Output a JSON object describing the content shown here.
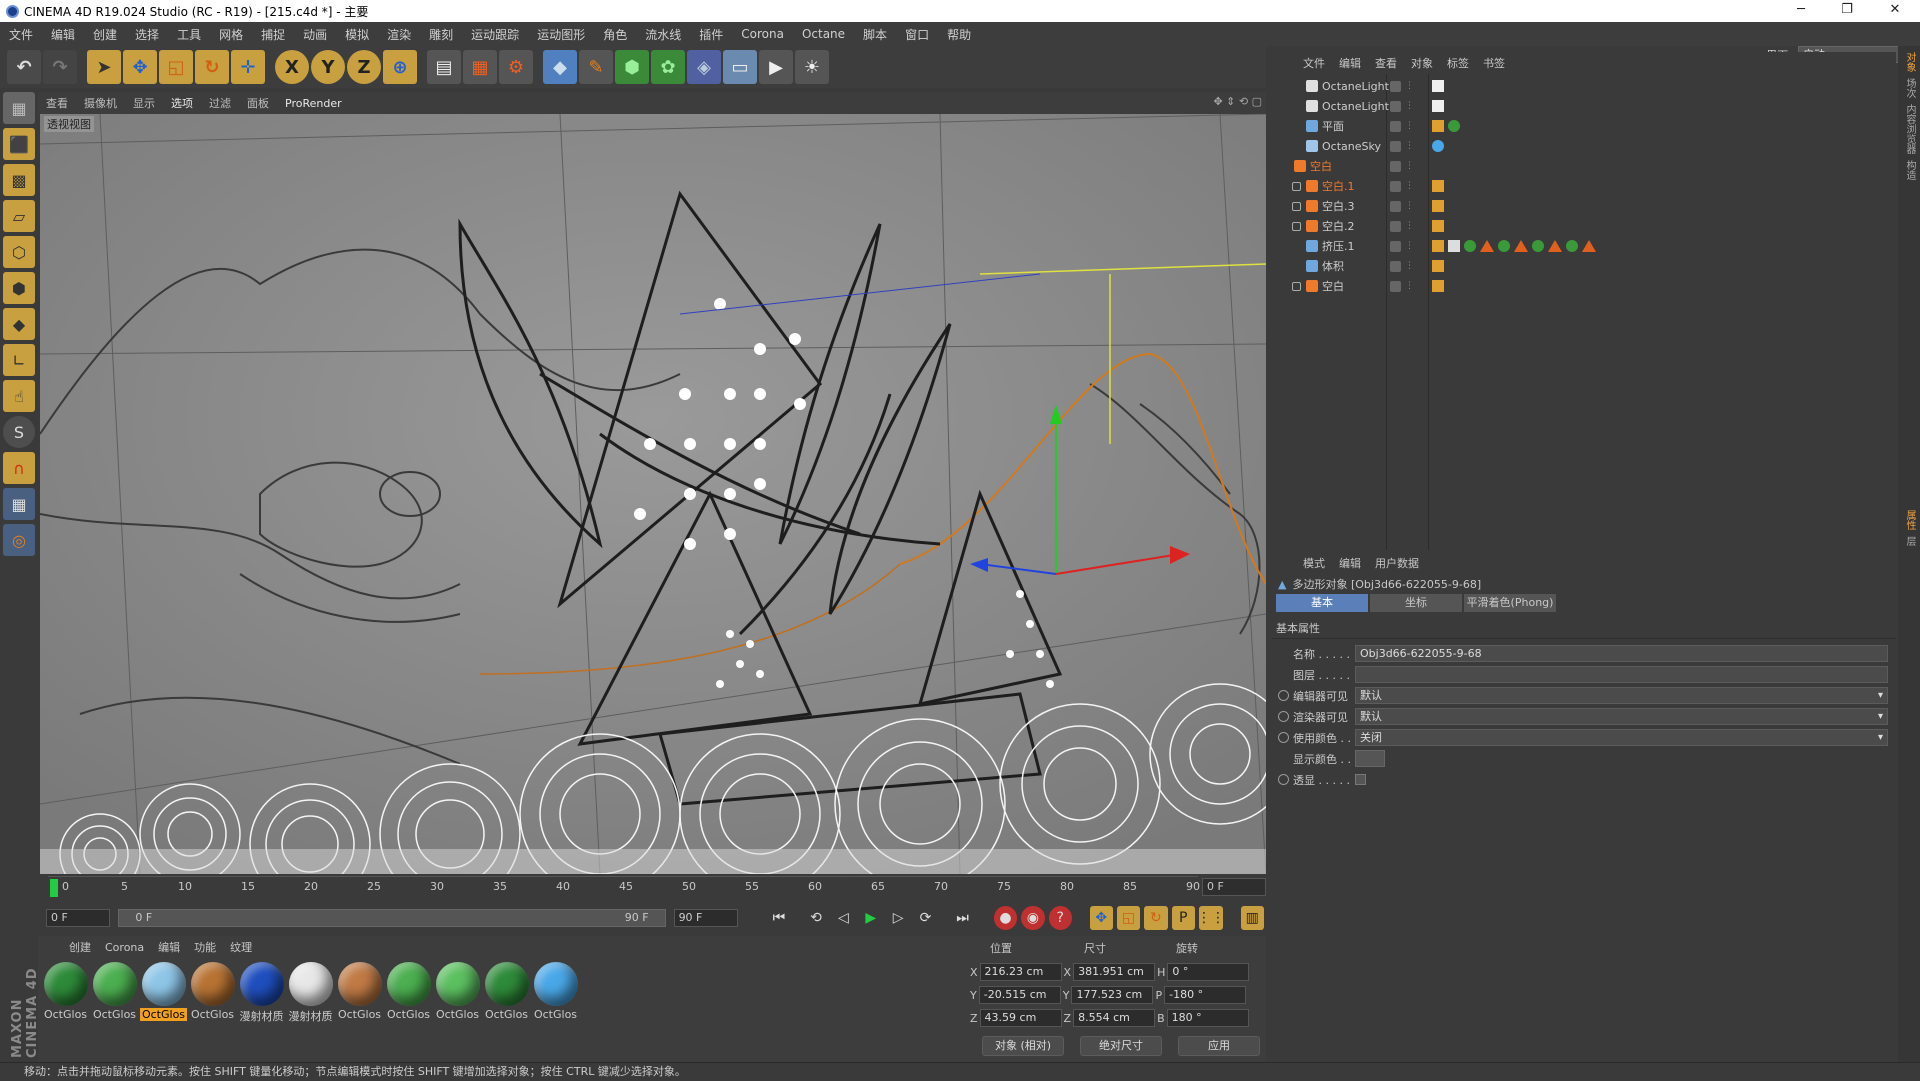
{
  "window": {
    "title": "CINEMA 4D R19.024 Studio (RC - R19) - [215.c4d *] - 主要",
    "min": "─",
    "max": "❐",
    "close": "✕"
  },
  "menu": [
    "文件",
    "编辑",
    "创建",
    "选择",
    "工具",
    "网格",
    "捕捉",
    "动画",
    "模拟",
    "渲染",
    "雕刻",
    "运动跟踪",
    "运动图形",
    "角色",
    "流水线",
    "插件",
    "Corona",
    "Octane",
    "脚本",
    "窗口",
    "帮助"
  ],
  "layout": {
    "label": "界面:",
    "value": "启动"
  },
  "toolbar_icons": [
    "undo-icon",
    "redo-icon",
    "select-arrow-icon",
    "move-icon",
    "scale-icon",
    "rotate-icon",
    "last-tool-icon",
    "x-axis-icon",
    "y-axis-icon",
    "z-axis-icon",
    "world-coord-icon",
    "render-view-icon",
    "render-picture-viewer-icon",
    "render-settings-icon",
    "cube-icon",
    "pen-spline-icon",
    "subdivision-icon",
    "array-icon",
    "deformer-icon",
    "floor-icon",
    "camera-icon",
    "light-icon"
  ],
  "toolbar_letters": {
    "x": "X",
    "y": "Y",
    "z": "Z"
  },
  "viewport_menu": [
    "查看",
    "摄像机",
    "显示",
    "选项",
    "过滤",
    "面板",
    "ProRender"
  ],
  "viewport_label": "透视视图",
  "timeline": {
    "ticks": [
      "0",
      "5",
      "10",
      "15",
      "20",
      "25",
      "30",
      "35",
      "40",
      "45",
      "50",
      "55",
      "60",
      "65",
      "70",
      "75",
      "80",
      "85",
      "90"
    ],
    "current_frame_field": "0 F"
  },
  "playback": {
    "start": "0 F",
    "range_start": "0 F",
    "range_end": "90 F",
    "end": "90 F"
  },
  "materials_menu": [
    "创建",
    "Corona",
    "编辑",
    "功能",
    "纹理"
  ],
  "materials": [
    {
      "label": "OctGlos",
      "color": "#2e8b3a",
      "selected": false
    },
    {
      "label": "OctGlos",
      "color": "#4caf50",
      "selected": false
    },
    {
      "label": "OctGlos",
      "color": "#8fc6e8",
      "selected": true
    },
    {
      "label": "OctGlos",
      "color": "#b87333",
      "selected": false
    },
    {
      "label": "漫射材质",
      "color": "#1f4fbf",
      "selected": false
    },
    {
      "label": "漫射材质",
      "color": "#e8e8e8",
      "selected": false
    },
    {
      "label": "OctGlos",
      "color": "#c07a45",
      "selected": false
    },
    {
      "label": "OctGlos",
      "color": "#4caf50",
      "selected": false
    },
    {
      "label": "OctGlos",
      "color": "#5cc060",
      "selected": false
    },
    {
      "label": "OctGlos",
      "color": "#2e8b3a",
      "selected": false
    },
    {
      "label": "OctGlos",
      "color": "#4aa8e8",
      "selected": false
    }
  ],
  "coords": {
    "headers": {
      "pos": "位置",
      "size": "尺寸",
      "rot": "旋转"
    },
    "rows": [
      {
        "axis": "X",
        "pos": "216.23 cm",
        "size_axis": "X",
        "size": "381.951 cm",
        "rot_axis": "H",
        "rot": "0 °"
      },
      {
        "axis": "Y",
        "pos": "-20.515 cm",
        "size_axis": "Y",
        "size": "177.523 cm",
        "rot_axis": "P",
        "rot": "-180 °"
      },
      {
        "axis": "Z",
        "pos": "43.59 cm",
        "size_axis": "Z",
        "size": "8.554 cm",
        "rot_axis": "B",
        "rot": "180 °"
      }
    ],
    "mode": "对象 (相对)",
    "size_mode": "绝对尺寸",
    "apply": "应用"
  },
  "object_menu": [
    "文件",
    "编辑",
    "查看",
    "对象",
    "标签",
    "书签"
  ],
  "objects": [
    {
      "name": "OctaneLight.1",
      "indent": 1,
      "selected": false,
      "icon": "#e0e0e0",
      "tags": [
        "light-tag"
      ]
    },
    {
      "name": "OctaneLight",
      "indent": 1,
      "selected": false,
      "icon": "#e0e0e0",
      "tags": [
        "light-tag"
      ]
    },
    {
      "name": "平面",
      "indent": 1,
      "selected": false,
      "icon": "#6fa8dc",
      "tags": [
        "display-tag",
        "material-tag"
      ]
    },
    {
      "name": "OctaneSky",
      "indent": 1,
      "selected": false,
      "icon": "#9fc5e8",
      "tags": [
        "sky-tag"
      ]
    },
    {
      "name": "空白",
      "indent": 0,
      "selected": true,
      "icon": "#f07a2b",
      "tags": []
    },
    {
      "name": "空白.1",
      "indent": 1,
      "selected": true,
      "icon": "#f07a2b",
      "tags": [
        "null-tag"
      ]
    },
    {
      "name": "空白.3",
      "indent": 1,
      "selected": false,
      "icon": "#f07a2b",
      "tags": [
        "null-tag"
      ]
    },
    {
      "name": "空白.2",
      "indent": 1,
      "selected": false,
      "icon": "#f07a2b",
      "tags": [
        "null-tag"
      ]
    },
    {
      "name": "挤压.1",
      "indent": 1,
      "selected": false,
      "icon": "#6fa8dc",
      "tags": [
        "phong-tag",
        "checker-tag",
        "material-tag",
        "triangle-tag",
        "material-tag",
        "triangle-tag",
        "material-tag",
        "triangle-tag",
        "material-tag",
        "triangle-tag"
      ]
    },
    {
      "name": "体积",
      "indent": 1,
      "selected": false,
      "icon": "#6fa8dc",
      "tags": [
        "phong-tag"
      ]
    },
    {
      "name": "空白",
      "indent": 1,
      "selected": false,
      "icon": "#f07a2b",
      "tags": [
        "null-tag"
      ]
    }
  ],
  "attr_menu": [
    "模式",
    "编辑",
    "用户数据"
  ],
  "attr_title": "多边形对象 [Obj3d66-622055-9-68]",
  "attr_tabs": [
    "基本",
    "坐标",
    "平滑着色(Phong)"
  ],
  "attr_section": "基本属性",
  "attr_rows": [
    {
      "label": "名称 . . . . .",
      "value": "Obj3d66-622055-9-68",
      "radio": false,
      "dd": false
    },
    {
      "label": "图层 . . . . .",
      "value": "",
      "radio": false,
      "dd": false
    },
    {
      "label": "编辑器可见",
      "value": "默认",
      "radio": true,
      "dd": true
    },
    {
      "label": "渲染器可见",
      "value": "默认",
      "radio": true,
      "dd": true
    },
    {
      "label": "使用颜色 . .",
      "value": "关闭",
      "radio": true,
      "dd": true
    },
    {
      "label": "显示颜色 . .",
      "value": "",
      "radio": false,
      "dd": false
    },
    {
      "label": "透显 . . . . .",
      "value": "",
      "radio": true,
      "dd": false
    }
  ],
  "right_strip": [
    "对象",
    "场次",
    "内容浏览器",
    "构造"
  ],
  "right_strip_lower": [
    "属性",
    "层"
  ],
  "maxon": "MAXON CINEMA 4D",
  "status": "移动：点击并拖动鼠标移动元素。按住 SHIFT 键量化移动；节点编辑模式时按住 SHIFT 键增加选择对象；按住 CTRL 键减少选择对象。",
  "colors": {
    "accent": "#f07a2b",
    "selection": "#5b7fb8",
    "viewport": "#8a8a8a"
  }
}
